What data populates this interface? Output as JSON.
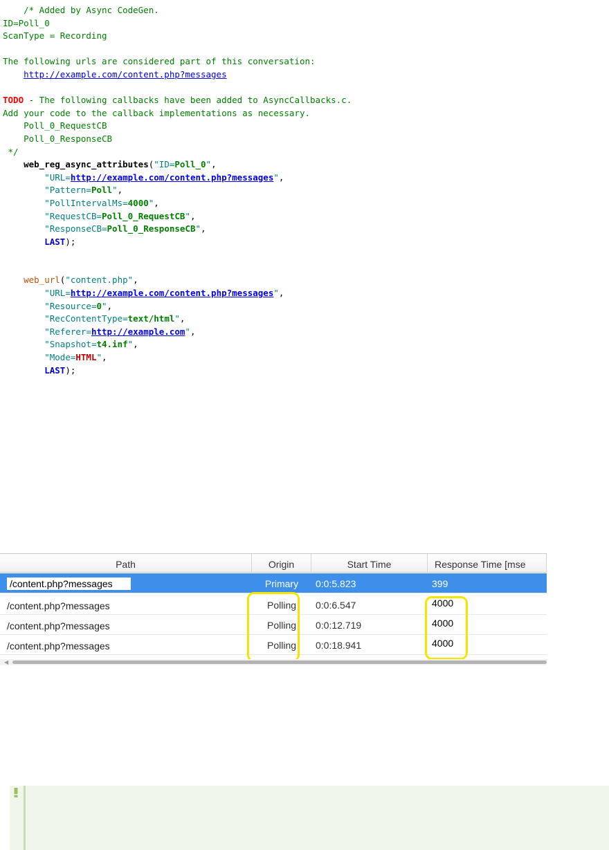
{
  "code_lines": [
    [
      {
        "t": "    /* Added by Async CodeGen.",
        "c": "c-com"
      }
    ],
    [
      {
        "t": "ID=Poll_0",
        "c": "c-com"
      }
    ],
    [
      {
        "t": "ScanType = Recording",
        "c": "c-com"
      }
    ],
    [
      {
        "t": "",
        "c": ""
      }
    ],
    [
      {
        "t": "The following urls are considered part of this conversation:",
        "c": "c-com"
      }
    ],
    [
      {
        "t": "    ",
        "c": ""
      },
      {
        "t": "http://example.com/content.php?messages",
        "c": "c-link"
      }
    ],
    [
      {
        "t": "",
        "c": ""
      }
    ],
    [
      {
        "t": "TODO",
        "c": "c-todo"
      },
      {
        "t": " - The following callbacks have been added to AsyncCallbacks.c.",
        "c": "c-com"
      }
    ],
    [
      {
        "t": "Add your code to the callback implementations as necessary.",
        "c": "c-com"
      }
    ],
    [
      {
        "t": "    Poll_0_RequestCB",
        "c": "c-com"
      }
    ],
    [
      {
        "t": "    Poll_0_ResponseCB",
        "c": "c-com"
      }
    ],
    [
      {
        "t": " */",
        "c": "c-com"
      }
    ],
    [
      {
        "t": "    ",
        "c": ""
      },
      {
        "t": "web_reg_async_attributes",
        "c": "c-fn"
      },
      {
        "t": "(",
        "c": ""
      },
      {
        "t": "\"ID=",
        "c": "c-str"
      },
      {
        "t": "Poll_0",
        "c": "c-val"
      },
      {
        "t": "\"",
        "c": "c-str"
      },
      {
        "t": ",",
        "c": ""
      }
    ],
    [
      {
        "t": "        ",
        "c": ""
      },
      {
        "t": "\"URL=",
        "c": "c-str"
      },
      {
        "t": "http://example.com/content.php?messages",
        "c": "c-lnk"
      },
      {
        "t": "\"",
        "c": "c-str"
      },
      {
        "t": ",",
        "c": ""
      }
    ],
    [
      {
        "t": "        ",
        "c": ""
      },
      {
        "t": "\"Pattern=",
        "c": "c-str"
      },
      {
        "t": "Poll",
        "c": "c-val"
      },
      {
        "t": "\"",
        "c": "c-str"
      },
      {
        "t": ",",
        "c": ""
      }
    ],
    [
      {
        "t": "        ",
        "c": ""
      },
      {
        "t": "\"PollIntervalMs=",
        "c": "c-str"
      },
      {
        "t": "4000",
        "c": "c-num"
      },
      {
        "t": "\"",
        "c": "c-str"
      },
      {
        "t": ",",
        "c": ""
      }
    ],
    [
      {
        "t": "        ",
        "c": ""
      },
      {
        "t": "\"RequestCB=",
        "c": "c-str"
      },
      {
        "t": "Poll_0_RequestCB",
        "c": "c-val"
      },
      {
        "t": "\"",
        "c": "c-str"
      },
      {
        "t": ",",
        "c": ""
      }
    ],
    [
      {
        "t": "        ",
        "c": ""
      },
      {
        "t": "\"ResponseCB=",
        "c": "c-str"
      },
      {
        "t": "Poll_0_ResponseCB",
        "c": "c-val"
      },
      {
        "t": "\"",
        "c": "c-str"
      },
      {
        "t": ",",
        "c": ""
      }
    ],
    [
      {
        "t": "        ",
        "c": ""
      },
      {
        "t": "LAST",
        "c": "c-kw"
      },
      {
        "t": ");",
        "c": ""
      }
    ],
    [
      {
        "t": "",
        "c": ""
      }
    ],
    [
      {
        "t": "",
        "c": ""
      }
    ],
    [
      {
        "t": "    ",
        "c": ""
      },
      {
        "t": "web_url",
        "c": "c-fn2"
      },
      {
        "t": "(",
        "c": ""
      },
      {
        "t": "\"content.php\"",
        "c": "c-str"
      },
      {
        "t": ",",
        "c": ""
      }
    ],
    [
      {
        "t": "        ",
        "c": ""
      },
      {
        "t": "\"URL=",
        "c": "c-str"
      },
      {
        "t": "http://example.com/content.php?messages",
        "c": "c-lnk"
      },
      {
        "t": "\"",
        "c": "c-str"
      },
      {
        "t": ",",
        "c": ""
      }
    ],
    [
      {
        "t": "        ",
        "c": ""
      },
      {
        "t": "\"Resource=",
        "c": "c-str"
      },
      {
        "t": "0",
        "c": "c-num"
      },
      {
        "t": "\"",
        "c": "c-str"
      },
      {
        "t": ",",
        "c": ""
      }
    ],
    [
      {
        "t": "        ",
        "c": ""
      },
      {
        "t": "\"RecContentType=",
        "c": "c-str"
      },
      {
        "t": "text/html",
        "c": "c-val"
      },
      {
        "t": "\"",
        "c": "c-str"
      },
      {
        "t": ",",
        "c": ""
      }
    ],
    [
      {
        "t": "        ",
        "c": ""
      },
      {
        "t": "\"Referer=",
        "c": "c-str"
      },
      {
        "t": "http://example.com",
        "c": "c-lnk"
      },
      {
        "t": "\"",
        "c": "c-str"
      },
      {
        "t": ",",
        "c": ""
      }
    ],
    [
      {
        "t": "        ",
        "c": ""
      },
      {
        "t": "\"Snapshot=",
        "c": "c-str"
      },
      {
        "t": "t4.inf",
        "c": "c-val"
      },
      {
        "t": "\"",
        "c": "c-str"
      },
      {
        "t": ",",
        "c": ""
      }
    ],
    [
      {
        "t": "        ",
        "c": ""
      },
      {
        "t": "\"Mode=",
        "c": "c-str"
      },
      {
        "t": "HTML",
        "c": "c-valred"
      },
      {
        "t": "\"",
        "c": "c-str"
      },
      {
        "t": ",",
        "c": ""
      }
    ],
    [
      {
        "t": "        ",
        "c": ""
      },
      {
        "t": "LAST",
        "c": "c-kw"
      },
      {
        "t": ");",
        "c": ""
      }
    ]
  ],
  "grid": {
    "columns": [
      "Path",
      "Origin",
      "Start Time",
      "Response Time [mse"
    ],
    "rows": [
      {
        "path": "/content.php?messages",
        "origin": "Primary",
        "start": "0:0:5.823",
        "response": "399",
        "selected": true
      },
      {
        "path": "/content.php?messages",
        "origin": "Polling",
        "start": "0:0:6.547",
        "response": "4000",
        "selected": false
      },
      {
        "path": "/content.php?messages",
        "origin": "Polling",
        "start": "0:0:12.719",
        "response": "4000",
        "selected": false
      },
      {
        "path": "/content.php?messages",
        "origin": "Polling",
        "start": "0:0:18.941",
        "response": "4000",
        "selected": false
      }
    ]
  },
  "colors": {
    "highlight": "#f5e600",
    "selected_row": "#3d8fea",
    "note_bg": "#f1f6ea"
  },
  "note": {
    "icon": "exclamation-icon"
  }
}
